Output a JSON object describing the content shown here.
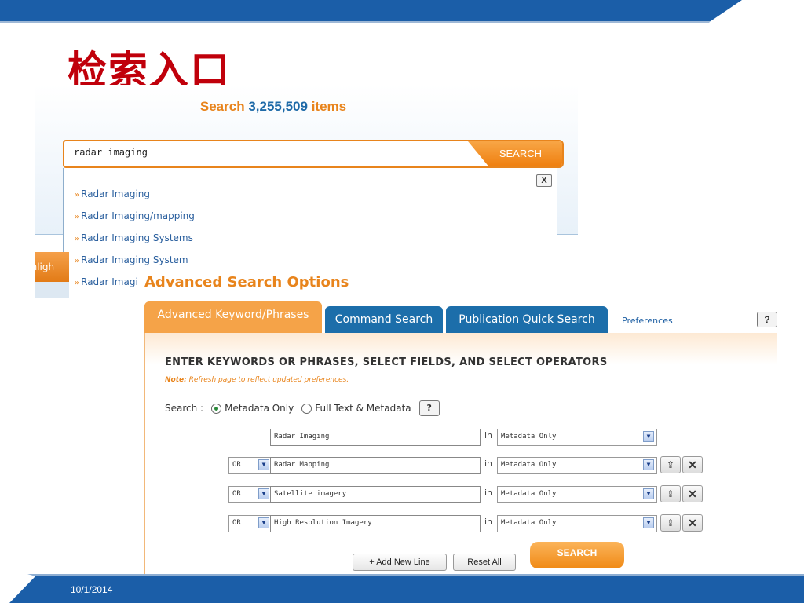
{
  "slide": {
    "title": "检索入口",
    "date": "10/1/2014",
    "colors": {
      "band": "#1b5ea8",
      "title": "#c0000b"
    }
  },
  "top_panel": {
    "heading_word": "Search",
    "heading_count": "3,255,509",
    "heading_suffix": "items",
    "search_value": "radar imaging",
    "search_button": "SEARCH",
    "close_label": "X",
    "suggestions": [
      "Radar Imaging",
      "Radar Imaging/mapping",
      "Radar Imaging Systems",
      "Radar Imaging System",
      "Radar Imaging"
    ],
    "left_tab_label": "ghligh",
    "colors": {
      "accent": "#e8841c",
      "count": "#1e6aa8",
      "link": "#2a5f9e"
    }
  },
  "bottom_panel": {
    "title": "Advanced Search Options",
    "tabs": [
      {
        "label": "Advanced Keyword/Phrases",
        "active": true
      },
      {
        "label": "Command Search",
        "active": false
      },
      {
        "label": "Publication Quick Search",
        "active": false
      }
    ],
    "preferences_label": "Preferences",
    "help_label": "?",
    "heading": "ENTER KEYWORDS OR PHRASES, SELECT FIELDS, AND SELECT OPERATORS",
    "note_label": "Note:",
    "note_text": "Refresh page to reflect updated preferences.",
    "search_label": "Search :",
    "radio_metadata": "Metadata Only",
    "radio_fulltext": "Full Text & Metadata",
    "radio_selected": "Metadata Only",
    "rows": [
      {
        "operator": "",
        "keyword": "Radar Imaging",
        "in_label": "in",
        "field": "Metadata Only"
      },
      {
        "operator": "OR",
        "keyword": "Radar Mapping",
        "in_label": "in",
        "field": "Metadata Only"
      },
      {
        "operator": "OR",
        "keyword": "Satellite imagery",
        "in_label": "in",
        "field": "Metadata Only"
      },
      {
        "operator": "OR",
        "keyword": "High Resolution Imagery",
        "in_label": "in",
        "field": "Metadata Only"
      }
    ],
    "add_line_label": "Add New Line",
    "reset_label": "Reset All",
    "search_label_btn": "SEARCH",
    "colors": {
      "tab_active": "#f5a348",
      "tab_inactive": "#1c6eaa",
      "accent": "#e8841c"
    }
  }
}
